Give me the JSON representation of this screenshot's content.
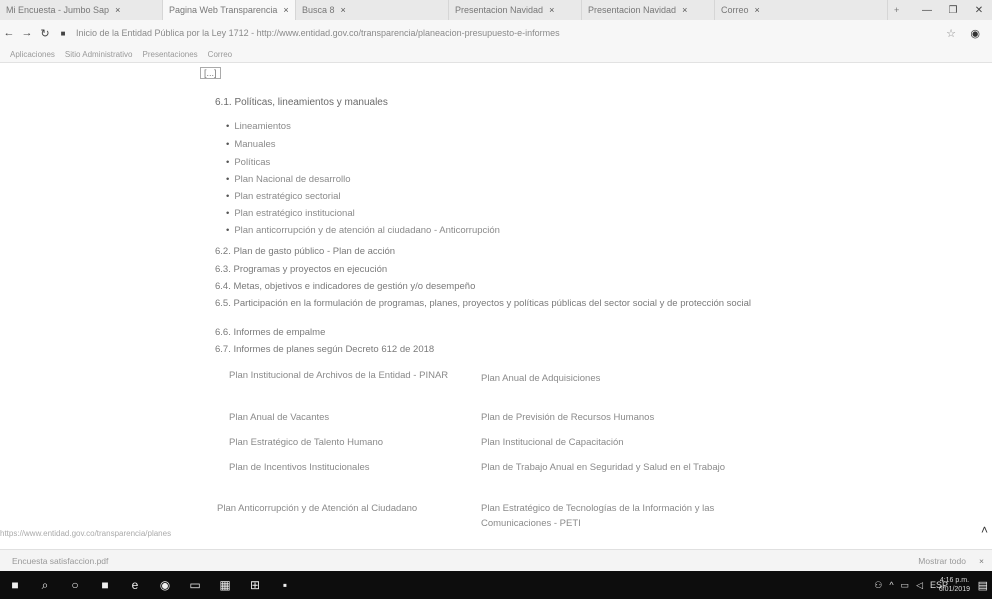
{
  "browser": {
    "tabs": [
      {
        "label": "Mi Encuesta - Jumbo Sap",
        "active": false
      },
      {
        "label": "Pagina Web Transparencia",
        "active": true
      },
      {
        "label": "Busca 8",
        "active": false
      },
      {
        "label": "Presentacion Navidad",
        "active": false
      },
      {
        "label": "Presentacion Navidad",
        "active": false
      },
      {
        "label": "Correo",
        "active": false
      }
    ],
    "url": "Inicio de la Entidad Pública por la Ley 1712 - http://www.entidad.gov.co/transparencia/planeacion-presupuesto-e-informes",
    "bookmarks": [
      "Aplicaciones",
      "Sitio Administrativo",
      "Presentaciones",
      "Correo"
    ]
  },
  "page": {
    "ellipsis": "[...]",
    "heading": "6.1. Políticas, lineamientos y manuales",
    "bullets": [
      "Lineamientos",
      "Manuales",
      "Políticas",
      "Plan Nacional de desarrollo",
      "Plan estratégico sectorial",
      "Plan estratégico institucional",
      "Plan anticorrupción y de atención al ciudadano - Anticorrupción"
    ],
    "sections": [
      "6.2. Plan de gasto público - Plan de acción",
      "6.3. Programas y proyectos en ejecución",
      "6.4. Metas, objetivos e indicadores de gestión y/o desempeño",
      "6.5. Participación en la formulación de programas, planes, proyectos y políticas públicas del sector social y de protección social",
      "6.6. Informes de empalme",
      "6.7. Informes de planes según Decreto 612 de 2018"
    ],
    "plans_table": [
      [
        "Plan Institucional de Archivos de la Entidad - PINAR",
        "Plan Anual de Adquisiciones"
      ],
      [
        "Plan Anual de Vacantes",
        "Plan de Previsión de Recursos Humanos"
      ],
      [
        "Plan Estratégico de Talento Humano",
        "Plan Institucional de Capacitación"
      ],
      [
        "Plan de Incentivos Institucionales",
        "Plan de Trabajo Anual en Seguridad y Salud en el Trabajo"
      ],
      [
        "Plan Anticorrupción y de Atención al Ciudadano",
        "Plan Estratégico de Tecnologías de la Información y las Comunicaciones - PETI"
      ]
    ]
  },
  "status_url": "https://www.entidad.gov.co/transparencia/planes",
  "downloads": {
    "file": "Encuesta satisfaccion.pdf",
    "show_all": "Mostrar todo"
  },
  "taskbar": {
    "time": "4:16 p.m.",
    "date": "6/01/2019",
    "lang": "ESP"
  }
}
